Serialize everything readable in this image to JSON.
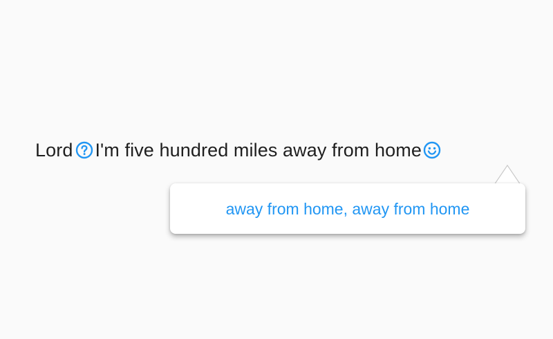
{
  "sentence": {
    "word_before": "Lord",
    "main_text": "I'm five hundred miles away from home",
    "help_icon": "help-circle-outline-icon",
    "smile_icon": "emoticon-smile-outline-icon"
  },
  "tooltip": {
    "text": "away from home, away from home"
  },
  "colors": {
    "accent": "#2196f3",
    "text": "#1f1f1f",
    "background": "#fafafa",
    "tooltip_background": "#ffffff"
  }
}
